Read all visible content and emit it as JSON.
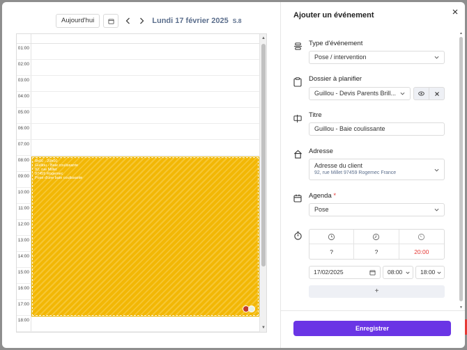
{
  "calendar": {
    "today_button": "Aujourd'hui",
    "date_label": "Lundi 17 février 2025",
    "week_label": "S.8",
    "hours": [
      "01:00",
      "02:00",
      "03:00",
      "04:00",
      "05:00",
      "06:00",
      "07:00",
      "08:00",
      "09:00",
      "10:00",
      "11:00",
      "12:00",
      "13:00",
      "14:00",
      "15:00",
      "16:00",
      "17:00",
      "18:00"
    ],
    "event": {
      "lines": [
        "8h00 - 20h00",
        "Guillou - Baie coulissante",
        "92, rue Millet",
        "97459 Rogemec",
        "Pose d'une baie coulissante"
      ]
    }
  },
  "form": {
    "title": "Ajouter un événement",
    "event_type": {
      "label": "Type d'événement",
      "value": "Pose / intervention"
    },
    "dossier": {
      "label": "Dossier à planifier",
      "value": "Guillou - Devis Parents Brill..."
    },
    "titre": {
      "label": "Titre",
      "value": "Guillou - Baie coulissante"
    },
    "adresse": {
      "label": "Adresse",
      "line1": "Adresse du client",
      "line2": "92, rue Millet 97459 Rogemec France"
    },
    "agenda": {
      "label": "Agenda",
      "required_mark": "*",
      "value": "Pose"
    },
    "duration": {
      "start": "?",
      "middle": "?",
      "end": "20:00"
    },
    "date": "17/02/2025",
    "start_time": "08:00",
    "end_time": "18:00",
    "add_label": "+",
    "save_label": "Enregistrer"
  },
  "colors": {
    "accent": "#6a35e5",
    "event": "#f2b705",
    "required": "#e53935",
    "muted_text": "#5b6e8c"
  }
}
